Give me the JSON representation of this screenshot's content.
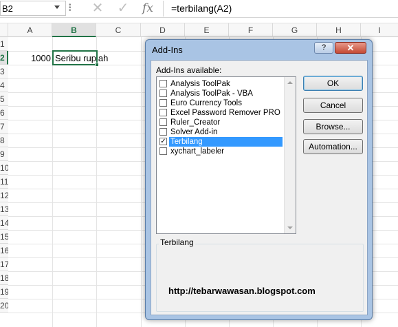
{
  "formula_bar": {
    "name_box": "B2",
    "cancel_symbol": "✕",
    "enter_symbol": "✓",
    "fx_label": "fx",
    "formula": "=terbilang(A2)"
  },
  "sheet": {
    "columns": [
      "A",
      "B",
      "C",
      "D",
      "E",
      "F",
      "G",
      "H",
      "I"
    ],
    "rows": [
      "1",
      "2",
      "3",
      "4",
      "5",
      "6",
      "7",
      "8",
      "9",
      "10",
      "11",
      "12",
      "13",
      "14",
      "15",
      "16",
      "17",
      "18",
      "19",
      "20"
    ],
    "cells": {
      "A2": "1000",
      "B2": "Seribu rupiah"
    }
  },
  "dialog": {
    "title": "Add-Ins",
    "help_label": "?",
    "close_label": "✕",
    "available_label": "Add-Ins available:",
    "items": [
      {
        "label": "Analysis ToolPak",
        "checked": false,
        "selected": false
      },
      {
        "label": "Analysis ToolPak - VBA",
        "checked": false,
        "selected": false
      },
      {
        "label": "Euro Currency Tools",
        "checked": false,
        "selected": false
      },
      {
        "label": "Excel Password Remover PRO",
        "checked": false,
        "selected": false
      },
      {
        "label": "Ruler_Creator",
        "checked": false,
        "selected": false
      },
      {
        "label": "Solver Add-in",
        "checked": false,
        "selected": false
      },
      {
        "label": "Terbilang",
        "checked": true,
        "selected": true
      },
      {
        "label": "xychart_labeler",
        "checked": false,
        "selected": false
      }
    ],
    "buttons": {
      "ok": "OK",
      "cancel": "Cancel",
      "browse": "Browse...",
      "automation": "Automation..."
    },
    "group_title": "Terbilang",
    "description": "http://tebarwawasan.blogspot.com"
  },
  "colors": {
    "excel_green": "#217346",
    "selection_blue": "#3399ff"
  }
}
